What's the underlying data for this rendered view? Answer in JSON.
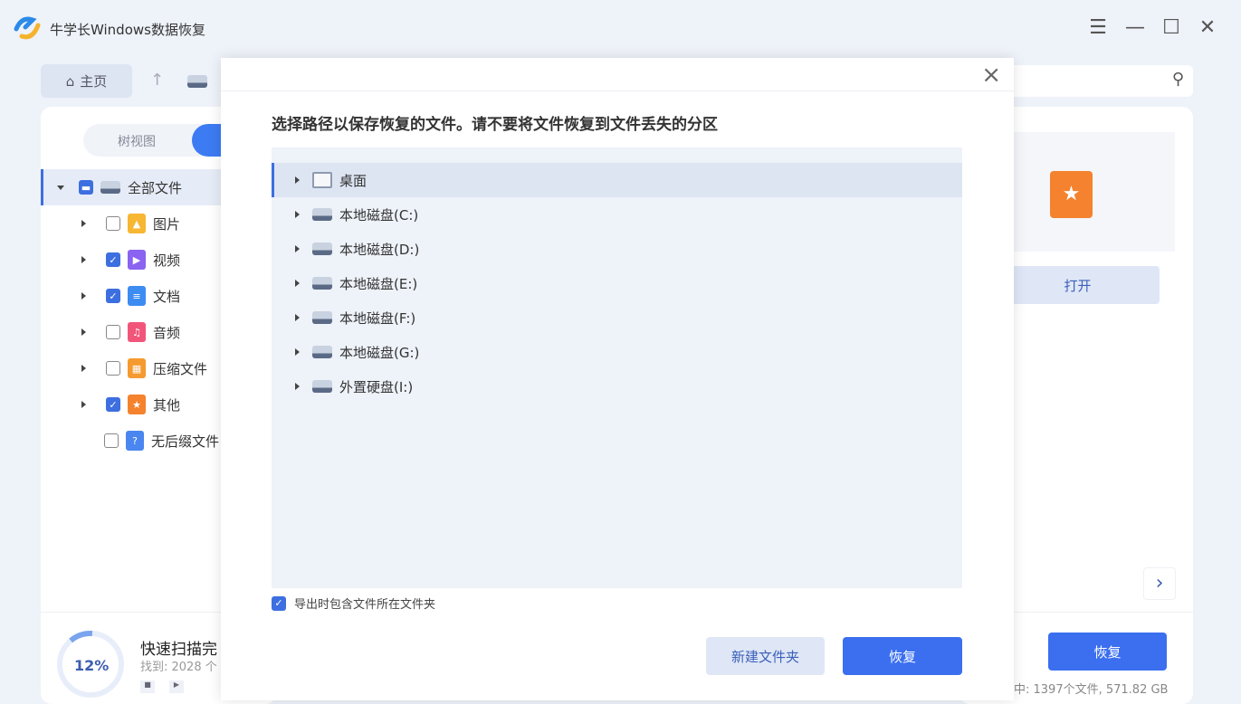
{
  "app": {
    "title": "牛学长Windows数据恢复"
  },
  "window_controls": [
    "menu-icon",
    "minimize-icon",
    "maximize-icon",
    "close-icon"
  ],
  "nav": {
    "home": "主页"
  },
  "left_panel": {
    "view_toggle": "树视图",
    "tree": [
      {
        "label": "全部文件",
        "state": "partial",
        "expanded": true,
        "color": "#5a6a86"
      },
      {
        "label": "图片",
        "state": "off",
        "color": "#f7b733"
      },
      {
        "label": "视频",
        "state": "on",
        "color": "#8a63f0"
      },
      {
        "label": "文档",
        "state": "on",
        "color": "#3d8cf2"
      },
      {
        "label": "音频",
        "state": "off",
        "color": "#f2557a"
      },
      {
        "label": "压缩文件",
        "state": "off",
        "color": "#f59a2e"
      },
      {
        "label": "其他",
        "state": "on",
        "color": "#f5822e"
      },
      {
        "label": "无后缀文件",
        "state": "off",
        "color": "#4a86f0"
      }
    ]
  },
  "scan": {
    "percent": 12,
    "percent_label": "12%",
    "title": "快速扫描完",
    "found": "找到: 2028 个"
  },
  "right_panel": {
    "open": "打开",
    "recover": "恢复",
    "selected": "中: 1397个文件, 571.82 GB"
  },
  "dialog": {
    "title": "选择路径以保存恢复的文件。请不要将文件恢复到文件丢失的分区",
    "locations": [
      {
        "label": "桌面",
        "type": "desktop"
      },
      {
        "label": "本地磁盘(C:)",
        "type": "drive"
      },
      {
        "label": "本地磁盘(D:)",
        "type": "drive"
      },
      {
        "label": "本地磁盘(E:)",
        "type": "drive"
      },
      {
        "label": "本地磁盘(F:)",
        "type": "drive"
      },
      {
        "label": "本地磁盘(G:)",
        "type": "drive"
      },
      {
        "label": "外置硬盘(I:)",
        "type": "usb"
      }
    ],
    "include_folder": "导出时包含文件所在文件夹",
    "include_folder_checked": true,
    "new_folder": "新建文件夹",
    "recover": "恢复"
  }
}
